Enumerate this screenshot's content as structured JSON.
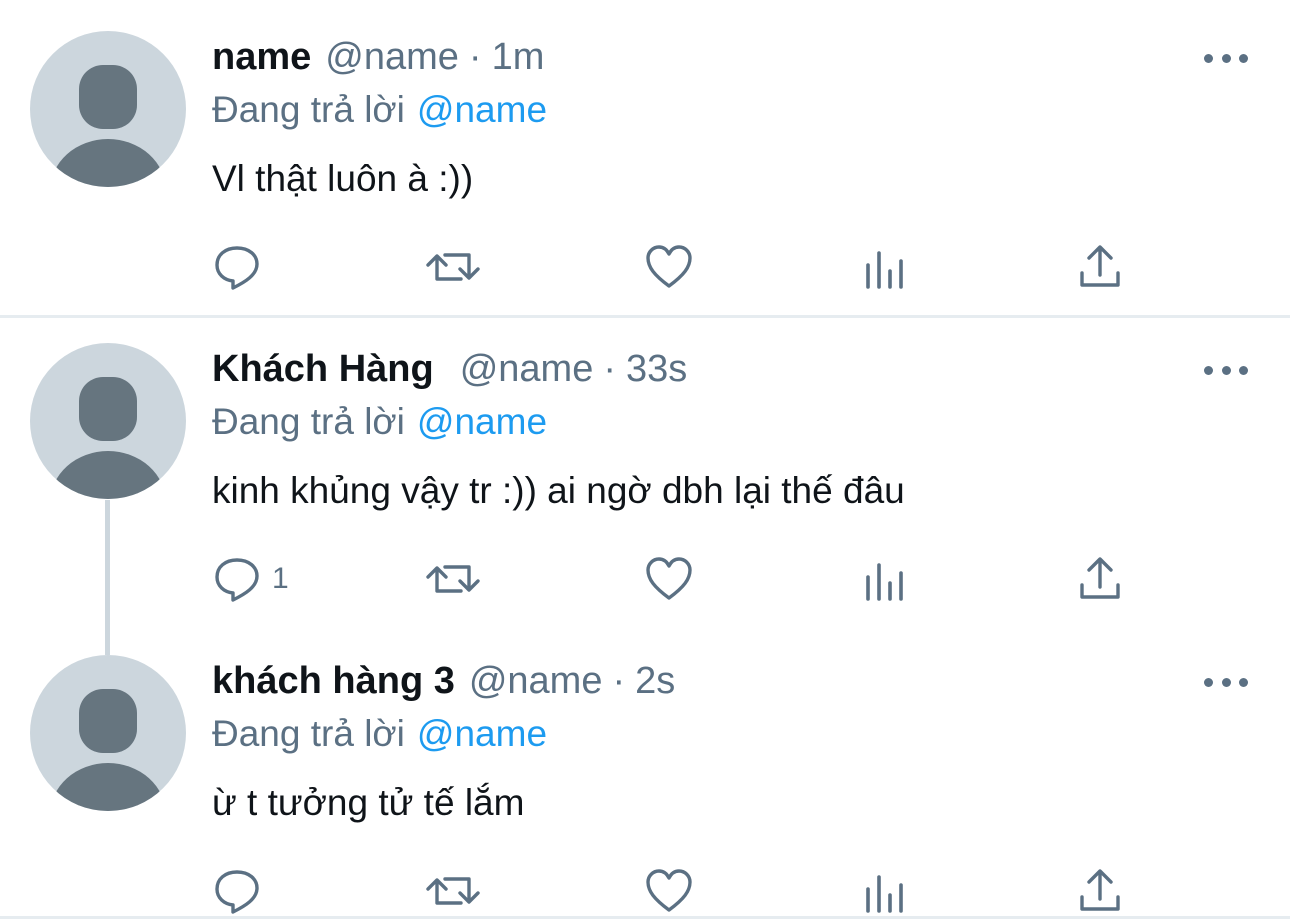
{
  "tweets": [
    {
      "display_name": "name",
      "handle": "@name",
      "separator": "·",
      "time": "1m",
      "replying_prefix": "Đang trả lời",
      "replying_mention": "@name",
      "text": "Vl thật luôn à :))",
      "reply_count": ""
    },
    {
      "display_name": "Khách Hàng",
      "handle": "@name",
      "separator": "·",
      "time": "33s",
      "replying_prefix": "Đang trả lời",
      "replying_mention": "@name",
      "text": "kinh khủng vậy tr :)) ai ngờ dbh lại thế đâu",
      "reply_count": "1"
    },
    {
      "display_name": "khách hàng 3",
      "handle": "@name",
      "separator": "·",
      "time": "2s",
      "replying_prefix": "Đang trả lời",
      "replying_mention": "@name",
      "text": "ừ t tưởng tử tế lắm",
      "reply_count": ""
    }
  ],
  "icons": {
    "reply": "reply-icon",
    "retweet": "retweet-icon",
    "like": "like-icon",
    "analytics": "analytics-icon",
    "share": "share-icon",
    "more": "more-icon",
    "avatar": "default-avatar-icon"
  },
  "colors": {
    "text": "#0f1419",
    "secondary": "#5b7083",
    "link": "#1d9bf0",
    "avatar_bg": "#ccd6dd",
    "avatar_fg": "#66757f",
    "divider": "#e6ecf0"
  }
}
